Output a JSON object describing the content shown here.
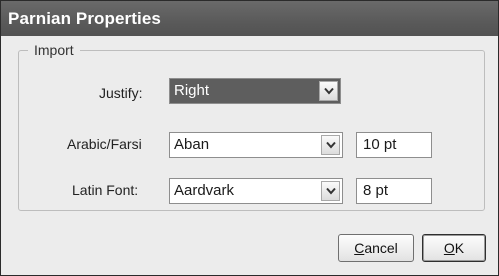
{
  "dialog": {
    "title": "Parnian Properties"
  },
  "import_group": {
    "legend": "Import"
  },
  "justify": {
    "label": "Justify:",
    "selected": "Right"
  },
  "arabic_farsi": {
    "label": "Arabic/Farsi",
    "font": "Aban",
    "size": "10 pt"
  },
  "latin_font": {
    "label": "Latin Font:",
    "font": "Aardvark",
    "size": "8 pt"
  },
  "buttons": {
    "cancel": {
      "mnemonic": "C",
      "rest": "ancel"
    },
    "ok": {
      "mnemonic": "O",
      "rest": "K"
    }
  },
  "icons": {
    "dropdown": "chevron-down-icon"
  }
}
